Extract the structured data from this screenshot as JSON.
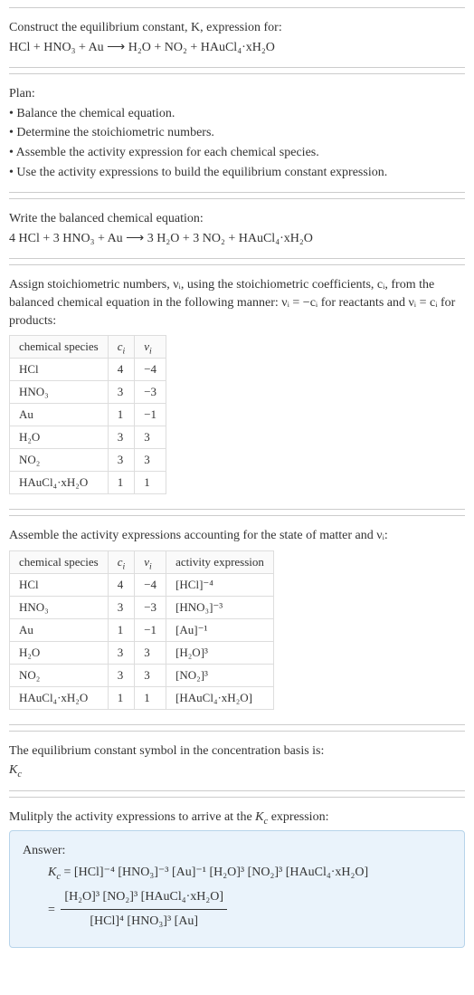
{
  "intro": {
    "title_line1": "Construct the equilibrium constant, K, expression for:",
    "equation": "HCl + HNO₃ + Au ⟶ H₂O + NO₂ + HAuCl₄·xH₂O"
  },
  "plan": {
    "heading": "Plan:",
    "items": [
      "• Balance the chemical equation.",
      "• Determine the stoichiometric numbers.",
      "• Assemble the activity expression for each chemical species.",
      "• Use the activity expressions to build the equilibrium constant expression."
    ]
  },
  "balanced": {
    "heading": "Write the balanced chemical equation:",
    "equation": "4 HCl + 3 HNO₃ + Au ⟶ 3 H₂O + 3 NO₂ + HAuCl₄·xH₂O"
  },
  "stoich": {
    "text": "Assign stoichiometric numbers, νᵢ, using the stoichiometric coefficients, cᵢ, from the balanced chemical equation in the following manner: νᵢ = −cᵢ for reactants and νᵢ = cᵢ for products:",
    "headers": [
      "chemical species",
      "cᵢ",
      "νᵢ"
    ],
    "rows": [
      {
        "sp": "HCl",
        "c": "4",
        "v": "−4"
      },
      {
        "sp": "HNO₃",
        "c": "3",
        "v": "−3"
      },
      {
        "sp": "Au",
        "c": "1",
        "v": "−1"
      },
      {
        "sp": "H₂O",
        "c": "3",
        "v": "3"
      },
      {
        "sp": "NO₂",
        "c": "3",
        "v": "3"
      },
      {
        "sp": "HAuCl₄·xH₂O",
        "c": "1",
        "v": "1"
      }
    ]
  },
  "activity": {
    "text": "Assemble the activity expressions accounting for the state of matter and νᵢ:",
    "headers": [
      "chemical species",
      "cᵢ",
      "νᵢ",
      "activity expression"
    ],
    "rows": [
      {
        "sp": "HCl",
        "c": "4",
        "v": "−4",
        "a": "[HCl]⁻⁴"
      },
      {
        "sp": "HNO₃",
        "c": "3",
        "v": "−3",
        "a": "[HNO₃]⁻³"
      },
      {
        "sp": "Au",
        "c": "1",
        "v": "−1",
        "a": "[Au]⁻¹"
      },
      {
        "sp": "H₂O",
        "c": "3",
        "v": "3",
        "a": "[H₂O]³"
      },
      {
        "sp": "NO₂",
        "c": "3",
        "v": "3",
        "a": "[NO₂]³"
      },
      {
        "sp": "HAuCl₄·xH₂O",
        "c": "1",
        "v": "1",
        "a": "[HAuCl₄·xH₂O]"
      }
    ]
  },
  "ksymbol": {
    "line1": "The equilibrium constant symbol in the concentration basis is:",
    "line2": "K_c"
  },
  "final": {
    "text": "Mulitply the activity expressions to arrive at the K_c expression:",
    "answer_label": "Answer:",
    "lhs": "K_c = ",
    "product": "[HCl]⁻⁴ [HNO₃]⁻³ [Au]⁻¹ [H₂O]³ [NO₂]³ [HAuCl₄·xH₂O]",
    "eq2_prefix": "= ",
    "frac_num": "[H₂O]³ [NO₂]³ [HAuCl₄·xH₂O]",
    "frac_den": "[HCl]⁴ [HNO₃]³ [Au]"
  }
}
